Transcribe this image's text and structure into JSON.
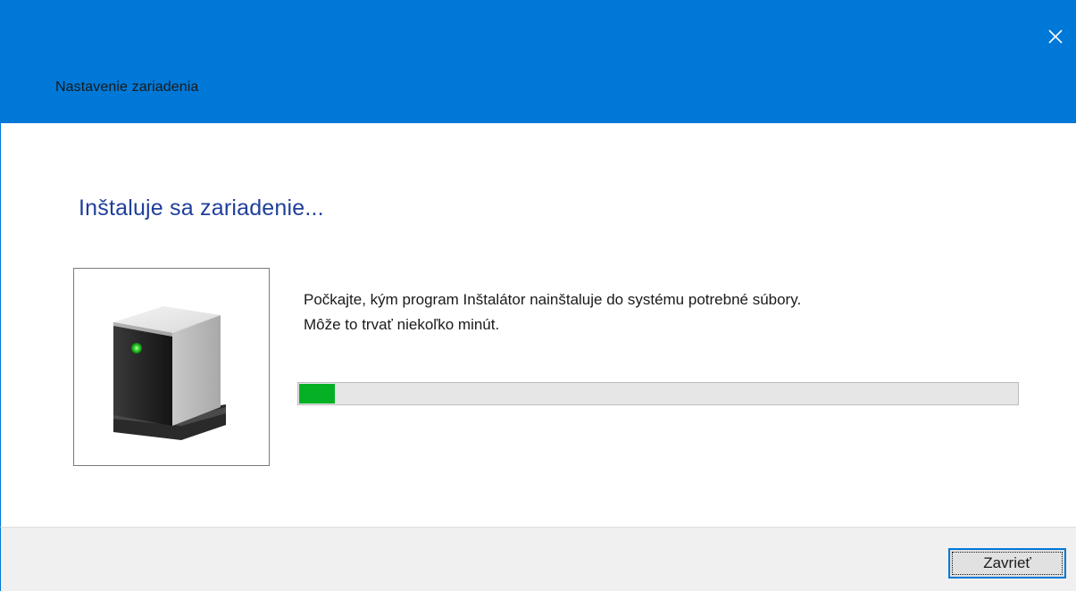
{
  "window": {
    "title": "Nastavenie zariadenia",
    "accent_color": "#0078d7",
    "close_icon": "close-icon"
  },
  "main": {
    "heading": "Inštaluje sa zariadenie...",
    "heading_color": "#1f3f9a",
    "device_icon": "device-icon",
    "message_line1": "Počkajte, kým program Inštalátor nainštaluje do systému potrebné súbory.",
    "message_line2": "Môže to trvať niekoľko minút.",
    "progress": {
      "fraction": 0.05,
      "fill_color": "#06b025",
      "track_color": "#e6e6e6"
    }
  },
  "footer": {
    "close_label": "Zavrieť"
  }
}
